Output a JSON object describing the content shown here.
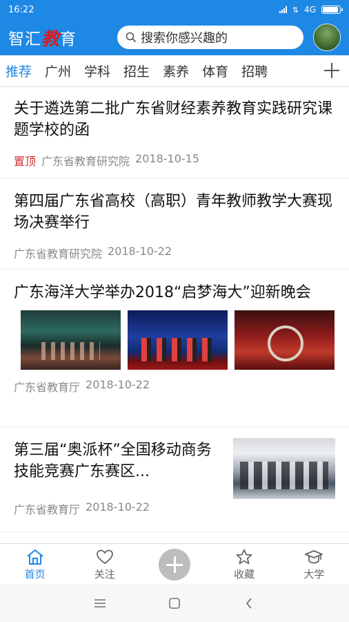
{
  "status_bar": {
    "time": "16:22",
    "network": "4G"
  },
  "header": {
    "logo_prefix": "智汇",
    "logo_accent": "教",
    "logo_suffix": "育",
    "search_placeholder": "搜索你感兴趣的",
    "brand_color": "#1e88e5"
  },
  "tabs": {
    "items": [
      "推荐",
      "广州",
      "学科",
      "招生",
      "素养",
      "体育",
      "招聘"
    ],
    "active_index": 0
  },
  "articles": [
    {
      "title": "关于遴选第二批广东省财经素养教育实践研究课题学校的函",
      "pin_label": "置顶",
      "source": "广东省教育研究院",
      "date": "2018-10-15"
    },
    {
      "title": "第四届广东省高校（高职）青年教师教学大赛现场决赛举行",
      "source": "广东省教育研究院",
      "date": "2018-10-22"
    },
    {
      "title": "广东海洋大学举办2018“启梦海大”迎新晚会",
      "source": "广东省教育厅",
      "date": "2018-10-22",
      "images": [
        "dance-performance-photo",
        "stage-choir-photo",
        "red-stage-photo"
      ]
    },
    {
      "title": "第三届“奥派杯”全国移动商务技能竞赛广东赛区...",
      "source": "广东省教育厅",
      "date": "2018-10-22",
      "image": "computer-lab-photo"
    }
  ],
  "bottom_nav": {
    "items": [
      {
        "label": "首页",
        "icon": "home-icon"
      },
      {
        "label": "关注",
        "icon": "heart-icon"
      },
      {
        "label": "",
        "icon": "add-icon"
      },
      {
        "label": "收藏",
        "icon": "star-icon"
      },
      {
        "label": "大学",
        "icon": "graduation-cap-icon"
      }
    ],
    "active_index": 0
  },
  "colors": {
    "accent": "#1e88e5",
    "pin": "#d32f2f",
    "logo_accent": "#d81b20"
  }
}
